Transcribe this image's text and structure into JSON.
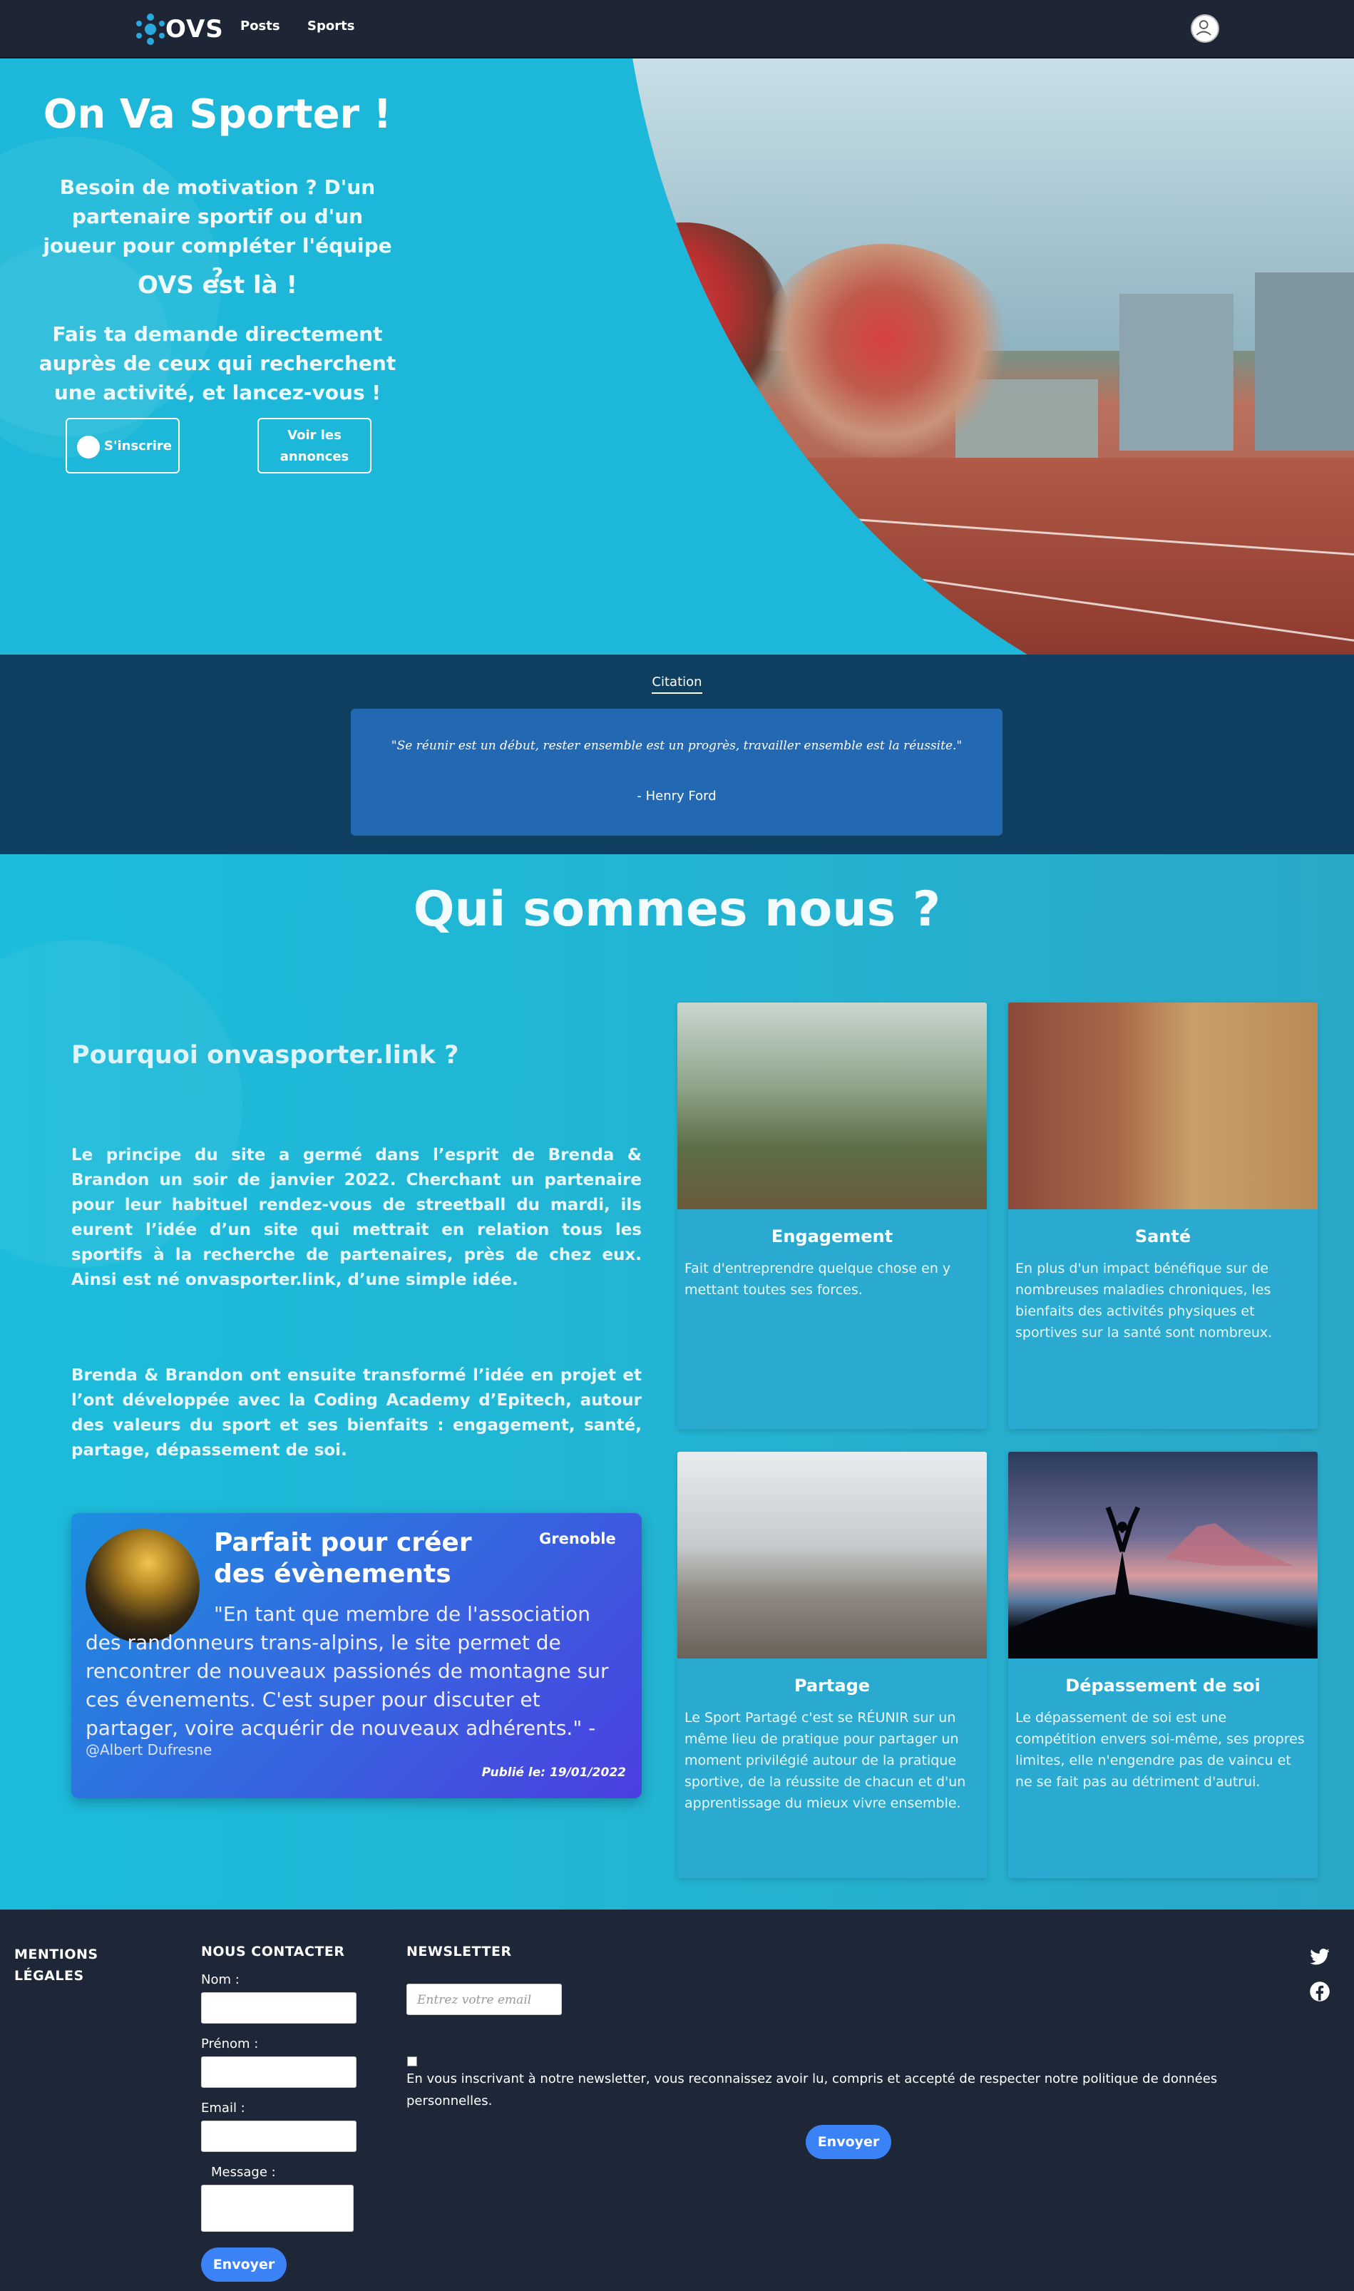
{
  "nav": {
    "logo_text": "OVS",
    "links": [
      "Posts",
      "Sports"
    ]
  },
  "hero": {
    "title": "On Va Sporter !",
    "p1": "Besoin de motivation ? D'un partenaire sportif ou d'un joueur pour compléter l'équipe ?",
    "p2": "OVS est là !",
    "p3": "Fais ta demande directement auprès de ceux qui recherchent une activité, et lancez-vous !",
    "signin_label": "S'inscrire",
    "annonces_label": "Voir les annonces"
  },
  "citation": {
    "title": "Citation",
    "quote": "\"Se réunir est un début, rester ensemble est un progrès, travailler ensemble est la réussite.\"",
    "author": "- Henry Ford"
  },
  "about": {
    "title": "Qui sommes nous ?",
    "subtitle": "Pourquoi onvasporter.link ?",
    "para1": "Le principe du site a germé dans l’esprit de Brenda & Brandon un soir de janvier 2022. Cherchant un partenaire pour leur habituel rendez-vous de streetball du mardi, ils eurent l’idée d’un site qui mettrait en relation tous les sportifs à la recherche de partenaires, près de chez eux. Ainsi est né onvasporter.link, d’une simple idée.",
    "para2": "Brenda & Brandon ont ensuite transformé l’idée en projet et l’ont développée avec la Coding Academy d’Epitech, autour des valeurs du sport et ses bienfaits : engagement, santé, partage, dépassement de soi.",
    "testimonial": {
      "title": "Parfait pour créer des évènements",
      "city": "Grenoble",
      "body": "\"En tant que membre de l'association des randonneurs trans-alpins, le site permet de rencontrer de nouveaux passionés de montagne sur ces évenements. C'est super pour discuter et partager, voire acquérir de nouveaux adhérents.\" -",
      "user": "@Albert Dufresne",
      "date": "Publié le: 19/01/2022"
    },
    "cards": [
      {
        "title": "Engagement",
        "desc": "Fait d'entreprendre quelque chose en y mettant toutes ses forces."
      },
      {
        "title": "Santé",
        "desc": "En plus d'un impact bénéfique sur de nombreuses maladies chroniques, les bienfaits des activités physiques et sportives sur la santé sont nombreux."
      },
      {
        "title": "Partage",
        "desc": "Le Sport Partagé c'est se RÉUNIR sur un même lieu de pratique pour partager un moment privilégié autour de la pratique sportive, de la réussite de chacun et d'un apprentissage du mieux vivre ensemble."
      },
      {
        "title": "Dépassement de soi",
        "desc": "Le dépassement de soi est une compétition envers soi-même, ses propres limites, elle n'engendre pas de vaincu et ne se fait pas au détriment d'autrui."
      }
    ]
  },
  "footer": {
    "legal_title_1": "MENTIONS",
    "legal_title_2": "LÉGALES",
    "contact_title": "NOUS CONTACTER",
    "nom_label": "Nom :",
    "prenom_label": "Prénom :",
    "email_label": "Email :",
    "message_label": "Message :",
    "contact_submit": "Envoyer",
    "newsletter_title": "NEWSLETTER",
    "newsletter_placeholder": "Entrez votre email",
    "newsletter_legal": "En vous inscrivant à notre newsletter, vous reconnaissez avoir lu, compris et accepté de respecter notre politique de données personnelles.",
    "newsletter_submit": "Envoyer",
    "social": [
      "twitter-icon",
      "facebook-icon"
    ]
  },
  "colors": {
    "nav_bg": "#1e2636",
    "hero_bg": "#1db8d9",
    "citation_bg": "#0f4062",
    "citation_box": "#2268b3",
    "footer_bg": "#1e2738",
    "button_blue": "#3b82f6"
  }
}
